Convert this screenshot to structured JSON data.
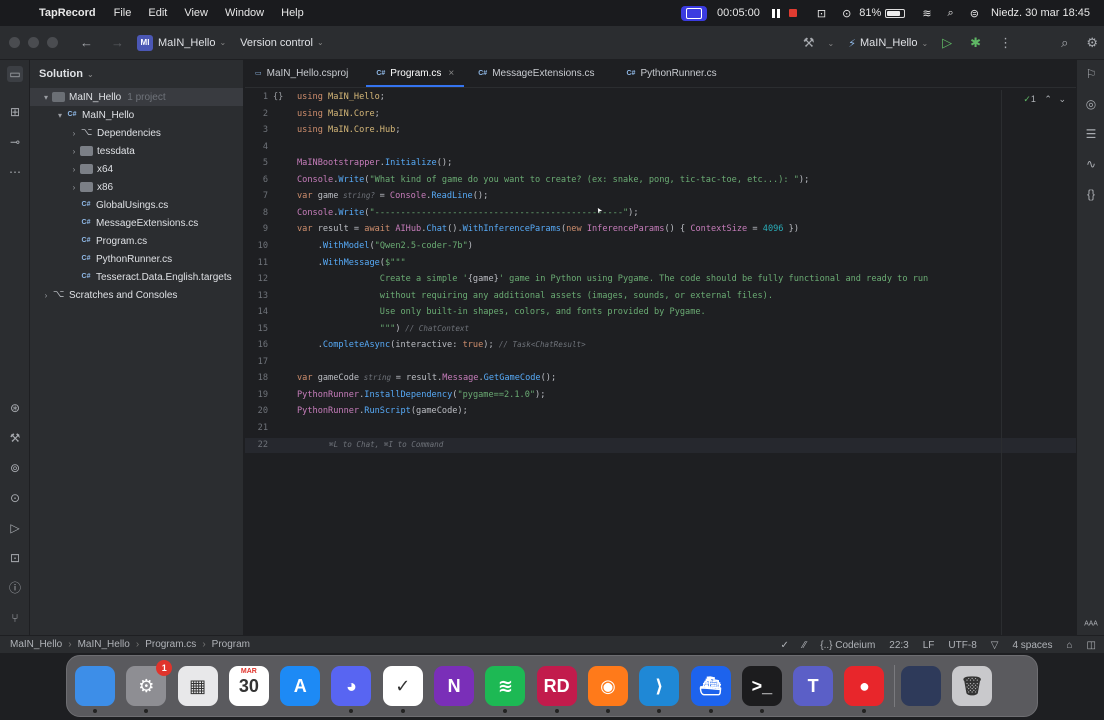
{
  "menubar": {
    "app": "TapRecord",
    "items": [
      "File",
      "Edit",
      "View",
      "Window",
      "Help"
    ],
    "timer": "00:05:00",
    "battery": "81%",
    "datetime": "Niedz. 30 mar  18:45"
  },
  "toolbar": {
    "project_badge": "MI",
    "project": "MaIN_Hello",
    "vcs": "Version control",
    "run_config": "MaIN_Hello"
  },
  "sidebar": {
    "title": "Solution",
    "items": [
      {
        "label": "MaIN_Hello",
        "note": "1 project",
        "depth": 0,
        "arrow": "▾",
        "icon": "sol",
        "selected": true
      },
      {
        "label": "MaIN_Hello",
        "depth": 1,
        "arrow": "▾",
        "icon": "cs"
      },
      {
        "label": "Dependencies",
        "depth": 2,
        "arrow": "›",
        "icon": "dep"
      },
      {
        "label": "tessdata",
        "depth": 2,
        "arrow": "›",
        "icon": "fold"
      },
      {
        "label": "x64",
        "depth": 2,
        "arrow": "›",
        "icon": "fold"
      },
      {
        "label": "x86",
        "depth": 2,
        "arrow": "›",
        "icon": "fold"
      },
      {
        "label": "GlobalUsings.cs",
        "depth": 2,
        "arrow": "",
        "icon": "cs"
      },
      {
        "label": "MessageExtensions.cs",
        "depth": 2,
        "arrow": "",
        "icon": "cs"
      },
      {
        "label": "Program.cs",
        "depth": 2,
        "arrow": "",
        "icon": "cs"
      },
      {
        "label": "PythonRunner.cs",
        "depth": 2,
        "arrow": "",
        "icon": "cs"
      },
      {
        "label": "Tesseract.Data.English.targets",
        "depth": 2,
        "arrow": "",
        "icon": "cs"
      },
      {
        "label": "Scratches and Consoles",
        "depth": 0,
        "arrow": "›",
        "icon": "dep"
      }
    ]
  },
  "tabs": [
    {
      "label": "MaIN_Hello.csproj",
      "active": false
    },
    {
      "label": "Program.cs",
      "active": true
    },
    {
      "label": "MessageExtensions.cs",
      "active": false
    },
    {
      "label": "PythonRunner.cs",
      "active": false
    }
  ],
  "editor": {
    "problems": "1",
    "lines": [
      [
        [
          "kw",
          "using "
        ],
        [
          "ns",
          "MaIN_Hello"
        ],
        [
          "",
          "; "
        ]
      ],
      [
        [
          "kw",
          "using "
        ],
        [
          "ns",
          "MaIN.Core"
        ],
        [
          "",
          ";"
        ]
      ],
      [
        [
          "kw",
          "using "
        ],
        [
          "ns",
          "MaIN.Core.Hub"
        ],
        [
          "",
          ";"
        ]
      ],
      [],
      [
        [
          "ty",
          "MaINBootstrapper"
        ],
        [
          "",
          "."
        ],
        [
          "mt",
          "Initialize"
        ],
        [
          "",
          "();"
        ]
      ],
      [
        [
          "ty",
          "Console"
        ],
        [
          "",
          "."
        ],
        [
          "mt",
          "Write"
        ],
        [
          "",
          "("
        ],
        [
          "str",
          "\"What kind of game do you want to create? (ex: snake, pong, tic-tac-toe, etc...): \""
        ],
        [
          "",
          ");"
        ]
      ],
      [
        [
          "kw",
          "var "
        ],
        [
          "",
          "game"
        ],
        [
          "hint",
          " string? "
        ],
        [
          "",
          ""
        ],
        [
          "",
          "= "
        ],
        [
          "ty",
          "Console"
        ],
        [
          "",
          "."
        ],
        [
          "mt",
          "ReadLine"
        ],
        [
          "",
          "();"
        ]
      ],
      [
        [
          "ty",
          "Console"
        ],
        [
          "",
          "."
        ],
        [
          "mt",
          "Write"
        ],
        [
          "",
          "("
        ],
        [
          "str",
          "\"------------------------------------------------\""
        ],
        [
          "",
          ");"
        ]
      ],
      [
        [
          "kw",
          "var "
        ],
        [
          "",
          "result = "
        ],
        [
          "kw",
          "await "
        ],
        [
          "ty",
          "AIHub"
        ],
        [
          "",
          "."
        ],
        [
          "mt",
          "Chat"
        ],
        [
          "",
          "()."
        ],
        [
          "mt",
          "WithInferenceParams"
        ],
        [
          "",
          "("
        ],
        [
          "kw",
          "new "
        ],
        [
          "ty",
          "InferenceParams"
        ],
        [
          "",
          "() { "
        ],
        [
          "ty",
          "ContextSize"
        ],
        [
          "",
          " = "
        ],
        [
          "num",
          "4096"
        ],
        [
          "",
          ""
        ],
        [
          "",
          " })"
        ]
      ],
      [
        [
          "",
          "    ."
        ],
        [
          "mt",
          "WithModel"
        ],
        [
          "",
          "("
        ],
        [
          "str",
          "\"Qwen2.5-coder-7b\""
        ],
        [
          "",
          ")"
        ]
      ],
      [
        [
          "",
          "    ."
        ],
        [
          "mt",
          "WithMessage"
        ],
        [
          "",
          "("
        ],
        [
          "str",
          "$\"\"\""
        ]
      ],
      [
        [
          "str",
          "                Create a simple '"
        ],
        [
          "",
          "{game}"
        ],
        [
          "str",
          "' game in Python using Pygame. The code should be fully functional and ready to run"
        ]
      ],
      [
        [
          "str",
          "                without requiring any additional assets (images, sounds, or external files)."
        ]
      ],
      [
        [
          "str",
          "                Use only built-in shapes, colors, and fonts provided by Pygame."
        ]
      ],
      [
        [
          "str",
          "                \"\"\""
        ],
        [
          "",
          ")"
        ],
        [
          "hint",
          " // ChatContext"
        ]
      ],
      [
        [
          "",
          "    ."
        ],
        [
          "mt",
          "CompleteAsync"
        ],
        [
          "",
          "(interactive: "
        ],
        [
          "kw",
          "true"
        ],
        [
          "",
          "); "
        ],
        [
          "hint",
          "// Task<ChatResult>"
        ]
      ],
      [],
      [
        [
          "kw",
          "var "
        ],
        [
          "",
          "gameCode"
        ],
        [
          "hint",
          " string "
        ],
        [
          "",
          ""
        ],
        [
          "",
          "= result."
        ],
        [
          "ty",
          "Message"
        ],
        [
          "",
          "."
        ],
        [
          "mt",
          "GetGameCode"
        ],
        [
          "",
          "();"
        ]
      ],
      [
        [
          "ty",
          "PythonRunner"
        ],
        [
          "",
          "."
        ],
        [
          "mt",
          "InstallDependency"
        ],
        [
          "",
          "("
        ],
        [
          "str",
          "\"pygame==2.1.0\""
        ],
        [
          "",
          ");"
        ]
      ],
      [
        [
          "ty",
          "PythonRunner"
        ],
        [
          "",
          "."
        ],
        [
          "mt",
          "RunScript"
        ],
        [
          "",
          "(gameCode);"
        ]
      ],
      [],
      [
        [
          "hint",
          "       ⌘L to Chat, ⌘I to Command"
        ]
      ]
    ]
  },
  "statusbar": {
    "crumbs": [
      "MaIN_Hello",
      "MaIN_Hello",
      "Program.cs",
      "Program"
    ],
    "codeium": "{..} Codeium",
    "pos": "22:3",
    "eol": "LF",
    "enc": "UTF-8",
    "indent": "4 spaces"
  },
  "dock": {
    "items": [
      {
        "name": "finder",
        "label": "",
        "color": "#3d8ee8",
        "dot": true
      },
      {
        "name": "system-settings",
        "label": "⚙",
        "color": "#8e8e93",
        "badge": "1",
        "dot": true
      },
      {
        "name": "launchpad",
        "label": "▦",
        "color": "#e8e8ea",
        "dot": false
      },
      {
        "name": "calendar",
        "label": "30",
        "color": "#ffffff",
        "top": "MAR",
        "dot": false
      },
      {
        "name": "app-store",
        "label": "A",
        "color": "#1d8af5",
        "dot": false
      },
      {
        "name": "discord",
        "label": "◕",
        "color": "#5865f2",
        "dot": true
      },
      {
        "name": "tasks",
        "label": "✓",
        "color": "#ffffff",
        "dot": true
      },
      {
        "name": "onenote",
        "label": "N",
        "color": "#7a2fb8",
        "dot": false
      },
      {
        "name": "spotify",
        "label": "≋",
        "color": "#1db954",
        "dot": true
      },
      {
        "name": "rider",
        "label": "RD",
        "color": "#c21b4c",
        "dot": true
      },
      {
        "name": "firefox",
        "label": "◉",
        "color": "#ff7a1a",
        "dot": true
      },
      {
        "name": "vscode",
        "label": "⟩",
        "color": "#1f88d6",
        "dot": true
      },
      {
        "name": "docker",
        "label": "⛴",
        "color": "#1d63ed",
        "dot": true
      },
      {
        "name": "terminal",
        "label": ">_",
        "color": "#1c1c1e",
        "dot": true
      },
      {
        "name": "teams",
        "label": "T",
        "color": "#5b5fc7",
        "dot": false
      },
      {
        "name": "taprecord",
        "label": "●",
        "color": "#e8262b",
        "dot": true
      },
      {
        "name": "screenshot-preview",
        "label": "",
        "color": "#2e3a5a",
        "dot": false
      },
      {
        "name": "trash",
        "label": "🗑",
        "color": "#c9c9cc",
        "dot": false
      }
    ]
  }
}
